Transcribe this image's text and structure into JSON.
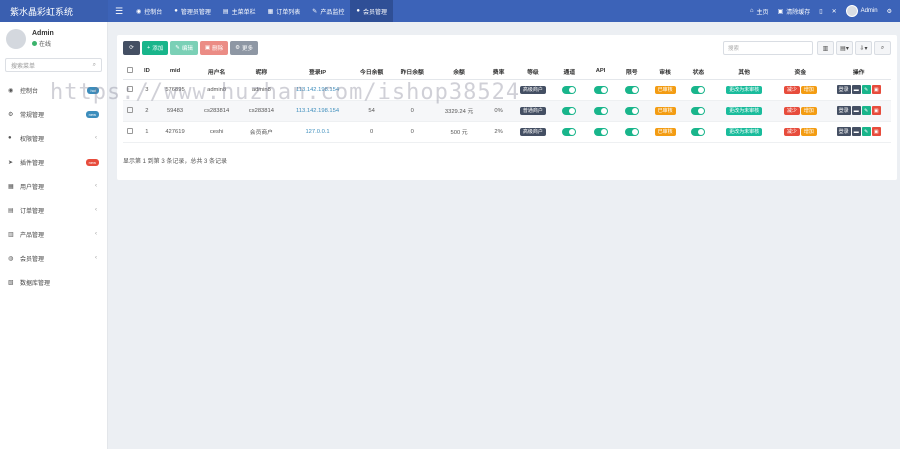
{
  "app": {
    "title": "紫水晶彩虹系统"
  },
  "topnav": [
    {
      "icon": "dashboard-icon",
      "glyph": "◉",
      "label": "控制台"
    },
    {
      "icon": "user-icon",
      "glyph": "●",
      "label": "管理员管理"
    },
    {
      "icon": "list-icon",
      "glyph": "▤",
      "label": "主菜单栏"
    },
    {
      "icon": "calendar-icon",
      "glyph": "▦",
      "label": "订单列表"
    },
    {
      "icon": "wrench-icon",
      "glyph": "✎",
      "label": "产品监控"
    },
    {
      "icon": "person-icon",
      "glyph": "●",
      "label": "会员管理"
    }
  ],
  "topright": {
    "home": "主页",
    "cache": "清除缓存",
    "user": "Admin"
  },
  "sidebar": {
    "user": {
      "name": "Admin",
      "status": "在线"
    },
    "search_placeholder": "搜索菜单",
    "items": [
      {
        "label": "控制台",
        "badge": "hot",
        "badge_color": "blue",
        "icon": "dashboard-icon",
        "glyph": "◉"
      },
      {
        "label": "常规管理",
        "badge": "new",
        "badge_color": "blue",
        "icon": "gear-icon",
        "glyph": "⚙"
      },
      {
        "label": "权限管理",
        "arrow": "‹",
        "icon": "users-icon",
        "glyph": "●"
      },
      {
        "label": "插件管理",
        "badge": "new",
        "badge_color": "red",
        "icon": "rocket-icon",
        "glyph": "➤"
      },
      {
        "label": "用户管理",
        "arrow": "‹",
        "icon": "grid-icon",
        "glyph": "▦"
      },
      {
        "label": "订单管理",
        "arrow": "‹",
        "icon": "order-icon",
        "glyph": "▤"
      },
      {
        "label": "产品管理",
        "arrow": "‹",
        "icon": "product-icon",
        "glyph": "▥"
      },
      {
        "label": "会员管理",
        "arrow": "‹",
        "icon": "member-icon",
        "glyph": "◍"
      },
      {
        "label": "数据库管理",
        "icon": "database-icon",
        "glyph": "▧"
      }
    ]
  },
  "toolbar": {
    "add": "添加",
    "edit": "编辑",
    "delete": "删除",
    "more": "更多",
    "search_placeholder": "搜索"
  },
  "table": {
    "headers": [
      "ID",
      "mid",
      "用户名",
      "昵称",
      "登录IP",
      "今日余额",
      "昨日余额",
      "余额",
      "费率",
      "等级",
      "通道",
      "API",
      "限号",
      "审核",
      "状态",
      "其他",
      "资金",
      "操作"
    ],
    "rows": [
      {
        "id": "3",
        "mid": "576895",
        "username": "admin8",
        "nick": "admin8",
        "ip": "113.142.198.154",
        "today": "",
        "yesterday": "",
        "balance": "",
        "rate": "",
        "level": "高级商户",
        "audit": "已审核",
        "other": "更改为未审核",
        "fund_a": "减少",
        "fund_b": "增加",
        "op": "登录"
      },
      {
        "id": "2",
        "mid": "59483",
        "username": "cs283814",
        "nick": "cs283814",
        "ip": "113.142.198.154",
        "today": "54",
        "yesterday": "0",
        "balance": "3329.24 元",
        "rate": "0%",
        "level": "普通商户",
        "audit": "已审核",
        "other": "更改为未审核",
        "fund_a": "减少",
        "fund_b": "增加",
        "op": "登录"
      },
      {
        "id": "1",
        "mid": "427619",
        "username": "ceshi",
        "nick": "会员商户",
        "ip": "127.0.0.1",
        "today": "0",
        "yesterday": "0",
        "balance": "500 元",
        "rate": "2%",
        "level": "高级商户",
        "audit": "已审核",
        "other": "更改为未审核",
        "fund_a": "减少",
        "fund_b": "增加",
        "op": "登录"
      }
    ],
    "footer": "显示第 1 到第 3 条记录，总共 3 条记录"
  },
  "watermark": "https://www.huzhan.com/ishop38524"
}
